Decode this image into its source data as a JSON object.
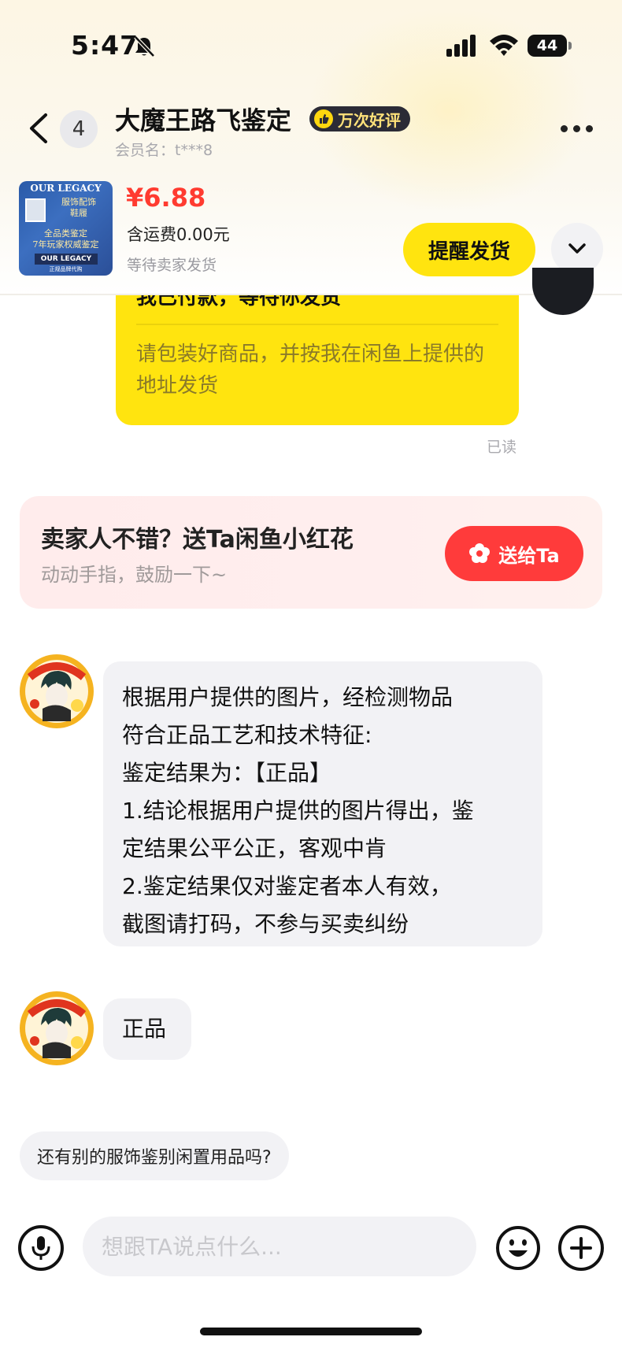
{
  "status_bar": {
    "time": "5:47",
    "battery": "44",
    "icons": [
      "bell-off-icon",
      "signal-icon",
      "wifi-icon",
      "battery-icon"
    ]
  },
  "header": {
    "unread_count": "4",
    "seller_name": "大魔王路飞鉴定",
    "praise_badge": "万次好评",
    "member_name": "会员名：t***8"
  },
  "order": {
    "thumbnail_text": {
      "title": "OUR LEGACY",
      "line1": "服饰配饰",
      "line2": "鞋履",
      "line3": "全品类鉴定",
      "line4": "7年玩家权威鉴定",
      "banner": "OUR LEGACY",
      "foot": "正规品牌代购"
    },
    "price": "¥6.88",
    "shipping": "含运费0.00元",
    "status": "等待卖家发货",
    "remind_label": "提醒发货"
  },
  "chat": {
    "payment_title": "我已付款，等待你发货",
    "payment_desc": "请包装好商品，并按我在闲鱼上提供的地址发货",
    "read_status": "已读",
    "flower_card": {
      "title": "卖家人不错？送Ta闲鱼小红花",
      "subtitle": "动动手指，鼓励一下~",
      "button_label": "送给Ta"
    },
    "message_1_lines": [
      "根据用户提供的图片，经检测物品",
      "符合正品工艺和技术特征:",
      "鉴定结果为：【正品】",
      "1.结论根据用户提供的图片得出，鉴",
      "定结果公平公正，客观中肯",
      "2.鉴定结果仅对鉴定者本人有效，",
      "截图请打码，不参与买卖纠纷"
    ],
    "message_2": "正品",
    "quick_reply": "还有别的服饰鉴别闲置用品吗?"
  },
  "input_bar": {
    "placeholder": "想跟TA说点什么..."
  },
  "colors": {
    "accent_yellow": "#ffe40f",
    "price_red": "#ff3b30",
    "gift_red": "#ff3b3b",
    "bubble_gray": "#f2f2f5"
  }
}
